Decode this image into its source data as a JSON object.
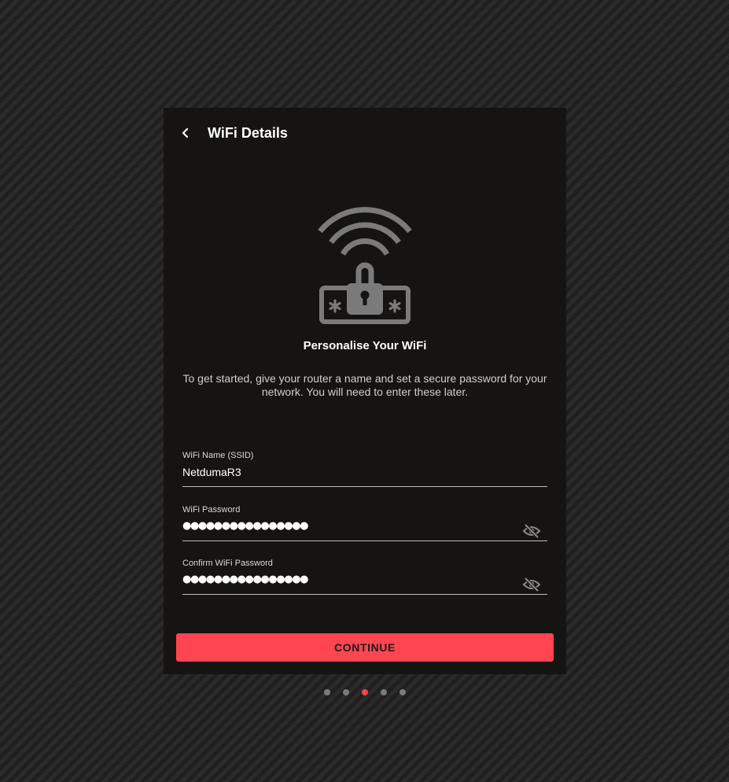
{
  "header": {
    "title": "WiFi Details",
    "back_icon": "chevron-left-icon"
  },
  "hero": {
    "icon": "wifi-lock-password-icon",
    "heading": "Personalise Your WiFi",
    "description": "To get started, give your router a name and set a secure password for your network. You will need to enter these later."
  },
  "form": {
    "ssid": {
      "label": "WiFi Name (SSID)",
      "value": "NetdumaR3"
    },
    "password": {
      "label": "WiFi Password",
      "masked_value": "●●●●●●●●●●●●●●●●",
      "visibility_icon": "eye-off-icon"
    },
    "confirm_password": {
      "label": "Confirm WiFi Password",
      "masked_value": "●●●●●●●●●●●●●●●●",
      "visibility_icon": "eye-off-icon"
    }
  },
  "actions": {
    "continue_label": "CONTINUE"
  },
  "stepper": {
    "total_steps": 5,
    "current_step": 3
  },
  "colors": {
    "accent": "#ff4551",
    "card_background": "#151413",
    "icon_gray": "#7a7a7a",
    "inactive_dot": "#7b7b7b"
  }
}
